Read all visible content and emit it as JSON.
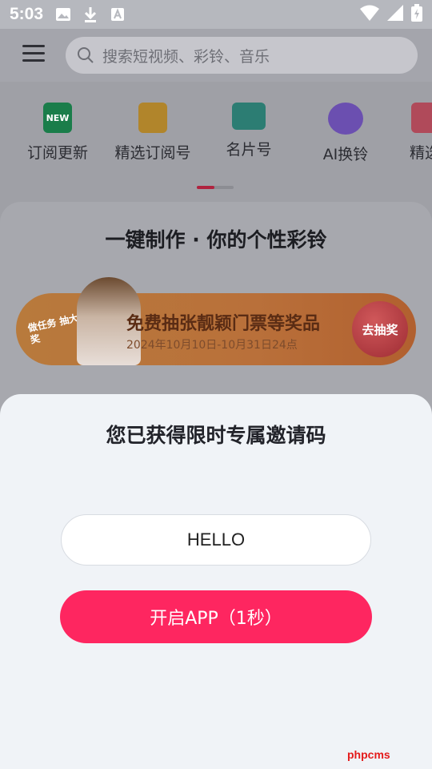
{
  "status_bar": {
    "time": "5:03",
    "icons": [
      "image-icon",
      "download-icon",
      "a-icon"
    ],
    "right_icons": [
      "wifi-icon",
      "signal-icon",
      "battery-icon"
    ]
  },
  "header": {
    "menu_icon": "menu-icon",
    "search_placeholder": "搜索短视频、彩铃、音乐"
  },
  "shortcuts": [
    {
      "label": "订阅更新",
      "icon": "new-icon",
      "color": "#1a7d4a",
      "badge": "NEW"
    },
    {
      "label": "精选订阅号",
      "icon": "star-badge-icon",
      "color": "#b1852b"
    },
    {
      "label": "名片号",
      "icon": "card-icon",
      "color": "#2c7d73"
    },
    {
      "label": "AI换铃",
      "icon": "ai-headphone-icon",
      "color": "#6b4fb0"
    },
    {
      "label": "精选",
      "icon": "heart-icon",
      "color": "#b04a5a"
    }
  ],
  "card": {
    "title": "一键制作 · 你的个性彩铃",
    "banner": {
      "tag": "做任务 抽大奖",
      "title": "免费抽张靓颖门票等奖品",
      "subtitle": "2024年10月10日-10月31日24点",
      "button": "去抽奖"
    }
  },
  "modal": {
    "title": "您已获得限时专属邀请码",
    "code": "HELLO",
    "button": "开启APP（1秒）",
    "accent": "#fe2660"
  },
  "watermark": "phpcms"
}
